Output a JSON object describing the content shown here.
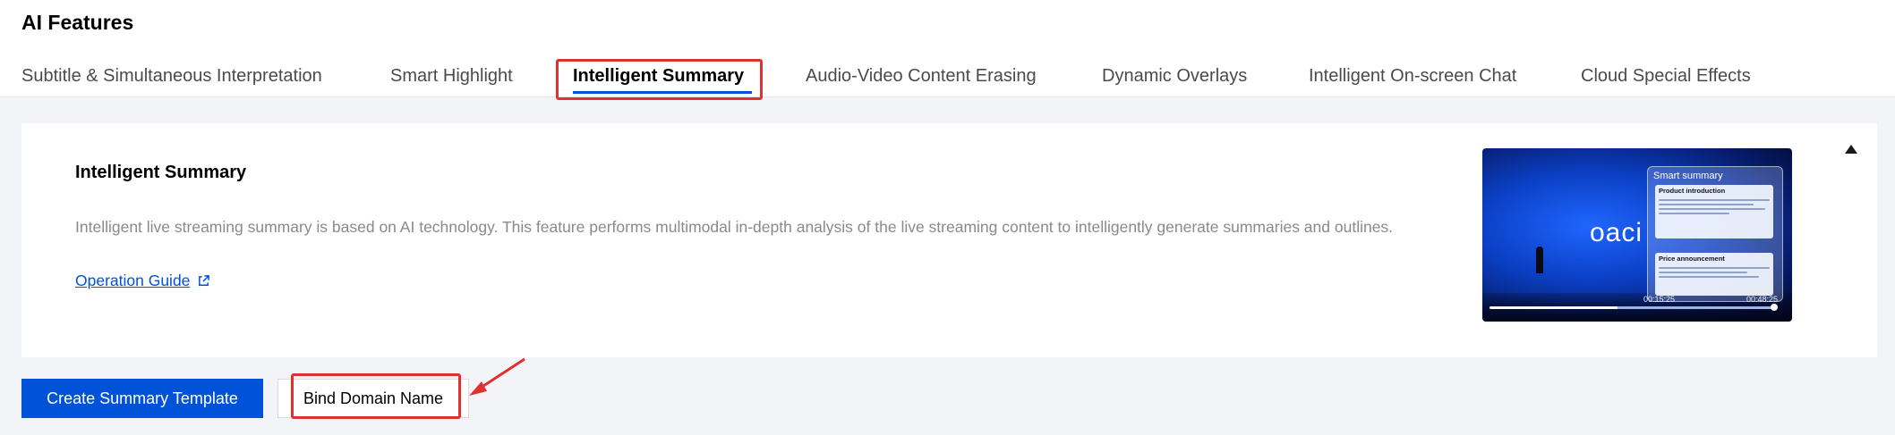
{
  "app_title": "AI Features",
  "tabs": [
    {
      "label": "Subtitle & Simultaneous Interpretation",
      "active": false
    },
    {
      "label": "Smart Highlight",
      "active": false
    },
    {
      "label": "Intelligent Summary",
      "active": true
    },
    {
      "label": "Audio-Video Content Erasing",
      "active": false
    },
    {
      "label": "Dynamic Overlays",
      "active": false
    },
    {
      "label": "Intelligent On-screen Chat",
      "active": false
    },
    {
      "label": "Cloud Special Effects",
      "active": false
    }
  ],
  "card": {
    "title": "Intelligent Summary",
    "description": "Intelligent live streaming summary is based on AI technology. This feature performs multimodal in-depth analysis of the live streaming content to intelligently generate summaries and outlines.",
    "guide_link": "Operation Guide",
    "guide_link_icon": "external-link-icon",
    "collapse_icon": "triangle-up-icon"
  },
  "preview": {
    "logo_text": "oaci",
    "panel_title": "Smart summary",
    "section1_title": "Product introduction",
    "section2_title": "Price announcement",
    "time_current": "00:15:25",
    "time_total": "00:48:25",
    "progress": 0.45
  },
  "actions": {
    "create_label": "Create Summary Template",
    "bind_label": "Bind Domain Name"
  },
  "colors": {
    "accent": "#0052d9",
    "annotation": "#e03030",
    "page_bg": "#f3f4f7"
  }
}
